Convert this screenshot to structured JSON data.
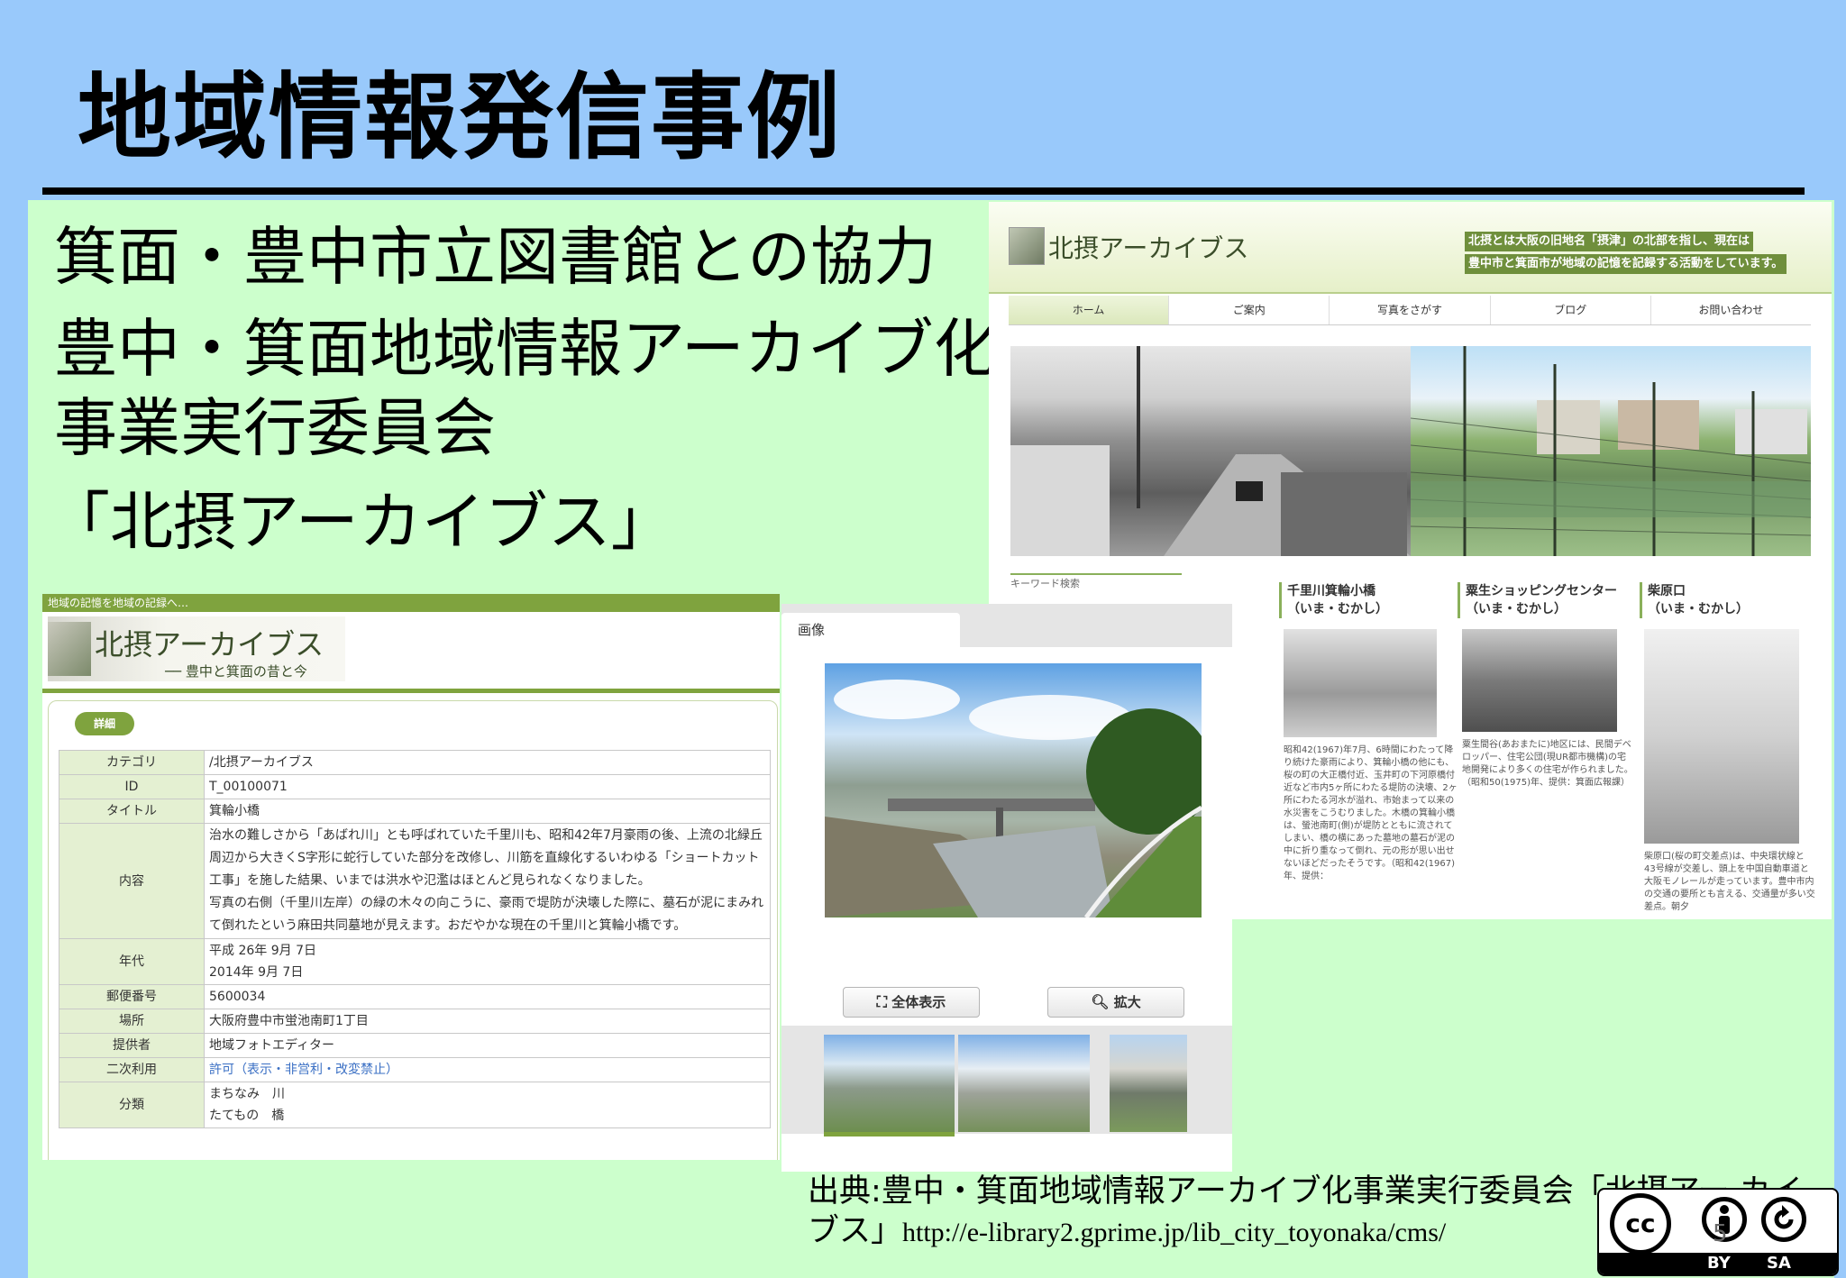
{
  "slide": {
    "title": "地域情報発信事例",
    "bullets": [
      "箕面・豊中市立図書館との協力",
      "豊中・箕面地域情報アーカイブ化",
      "事業実行委員会",
      "「北摂アーカイブス」"
    ],
    "citation_text": "出典:豊中・箕面地域情報アーカイブ化事業実行委員会「北摂アー カイブス」",
    "citation_url": "http://e-library2.gprime.jp/lib_city_toyonaka/cms/",
    "page_number": "5"
  },
  "site": {
    "logo": "北摂アーカイブス",
    "desc": [
      "北摂とは大阪の旧地名「摂津」の北部を指し、現在は",
      "豊中市と箕面市が地域の記憶を記録する活動をしています。"
    ],
    "nav": [
      "ホーム",
      "ご案内",
      "写真をさがす",
      "ブログ",
      "お問い合わせ"
    ],
    "keyword_search": "キーワード検索",
    "sections": [
      {
        "title": "千里川箕輪小橋\n（いま・むかし）",
        "body": "昭和42(1967)年7月、6時間にわたって降り続けた豪雨により、箕輪小橋の他にも、桜の町の大正橋付近、玉井町の下河原橋付近など市内5ヶ所にわたる堤防の決壊、2ヶ所にわたる河水が溢れ、市始まって以来の水災害をこうむりました。木橋の箕輪小橋は、螢池南町(側)が堤防とともに流されてしまい、橋の横にあった墓地の墓石が泥の中に折り重なって倒れ、元の形が思い出せないほどだったそうです。（昭和42(1967)年、提供："
      },
      {
        "title": "粟生ショッピングセンター（いま・むかし）",
        "body": "粟生間谷(あおまたに)地区には、民間デベロッパー、住宅公団(現UR都市機構)の宅地開発により多くの住宅が作られました。（昭和50(1975)年、提供：箕面広報課）"
      },
      {
        "title": "柴原口\n（いま・むかし）",
        "body": "柴原口(桜の町交差点)は、中央環状線と43号線が交差し、頭上を中国自動車道と大阪モノレールが走っています。豊中市内の交通の要所とも言える、交通量が多い交差点。朝夕"
      }
    ]
  },
  "detail": {
    "tagline": "地域の記憶を地域の記録へ…",
    "logo": "北摂アーカイブス",
    "logo_sub": "── 豊中と箕面の昔と今",
    "badge": "詳細",
    "rows": [
      {
        "key": "カテゴリ",
        "value": "/北摂アーカイブス"
      },
      {
        "key": "ID",
        "value": "T_00100071"
      },
      {
        "key": "タイトル",
        "value": "箕輪小橋"
      },
      {
        "key": "内容",
        "value": "治水の難しさから「あばれ川」とも呼ばれていた千里川も、昭和42年7月豪雨の後、上流の北緑丘周辺から大きくS字形に蛇行していた部分を改修し、川筋を直線化するいわゆる「ショートカット工事」を施した結果、いまでは洪水や氾濫はほとんど見られなくなりました。\n写真の右側（千里川左岸）の緑の木々の向こうに、豪雨で堤防が決壊した際に、墓石が泥にまみれて倒れたという麻田共同墓地が見えます。おだやかな現在の千里川と箕輪小橋です。"
      },
      {
        "key": "年代",
        "value": "平成 26年 9月 7日\n2014年 9月 7日"
      },
      {
        "key": "郵便番号",
        "value": "5600034"
      },
      {
        "key": "場所",
        "value": "大阪府豊中市蛍池南町1丁目"
      },
      {
        "key": "提供者",
        "value": "地域フォトエディター"
      },
      {
        "key": "二次利用",
        "value": "許可（表示・非営利・改変禁止）"
      },
      {
        "key": "分類",
        "value": "まちなみ　川\nたてもの　橋"
      }
    ]
  },
  "viewer": {
    "tab": "画像",
    "btn_full": "全体表示",
    "btn_zoom": "拡大"
  },
  "license": {
    "cc": "cc",
    "by": "BY",
    "sa": "SA"
  },
  "colors": {
    "background": "#99c9fb",
    "panel": "#ccffcc",
    "accent_green": "#7fa33e"
  }
}
